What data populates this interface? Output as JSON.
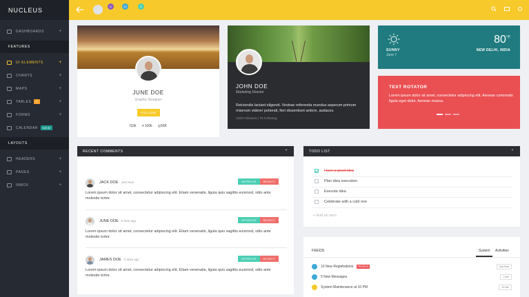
{
  "brand": "NUCLEUS",
  "sidebar": {
    "items_top": [
      {
        "label": "DASHBOARDS",
        "icon": "dashboard-icon"
      }
    ],
    "section_features": "FEATURES",
    "features": [
      {
        "label": "UI ELEMENTS",
        "icon": "ui-elements-icon",
        "active": true
      },
      {
        "label": "CHARTS",
        "icon": "charts-icon"
      },
      {
        "label": "MAPS",
        "icon": "maps-icon"
      },
      {
        "label": "TABLES",
        "icon": "tables-icon",
        "badge": "2"
      },
      {
        "label": "FORMS",
        "icon": "forms-icon"
      },
      {
        "label": "CALENDAR",
        "icon": "calendar-icon",
        "badge": "NEW"
      }
    ],
    "section_layouts": "LAYOUTS",
    "layouts": [
      {
        "label": "HEADERS",
        "icon": "headers-icon"
      },
      {
        "label": "PAGES",
        "icon": "pages-icon"
      },
      {
        "label": "INBOX",
        "icon": "inbox-icon"
      }
    ]
  },
  "topbar": {
    "badges": [
      "8",
      "10",
      "5"
    ]
  },
  "profile1": {
    "name": "JUNE DOE",
    "role": "Graphic Designer",
    "follow": "FOLLOW",
    "facebook": "10k",
    "twitter": "100k",
    "instagram": "50K"
  },
  "profile2": {
    "name": "JOHN DOE",
    "role": "Marketing Director",
    "bio": "Reiciendis lactant eligendi. Vestrae referenda mundus asperum primum miserum viderer potiendi, fieri dissentiunt ardore, audaces.",
    "followers": "1200 Followers",
    "following": "78 Following"
  },
  "weather": {
    "city": "SUNNY",
    "date": "June 7",
    "temp": "80",
    "unit": "°F",
    "location": "NEW DELHI, INDIA"
  },
  "rotator": {
    "title": "TEXT ROTATOR",
    "text": "Lorem ipsum dolor sit amet, consectetur adipiscing elit. Aenean commodo ligula eget dolor. Aenean massa."
  },
  "comments": {
    "title": "RECENT COMMENTS",
    "approve": "APPROVE",
    "reject": "REJECT",
    "items": [
      {
        "name": "JACK DOE",
        "time": "Just Now",
        "text": "Lorem ipsum dolor sit amet, consectetur adipiscing elit. Etiam venenatis, ligula quis sagittis euismod, odio ante molestie tortor."
      },
      {
        "name": "JUNE DOE",
        "time": "5 hour ago",
        "text": "Lorem ipsum dolor sit amet, consectetur adipiscing elit. Etiam venenatis, ligula quis sagittis euismod, odio ante molestie tortor."
      },
      {
        "name": "JAMES DOE",
        "time": "2 days ago",
        "text": "Lorem ipsum dolor sit amet, consectetur adipiscing elit. Etiam venenatis, ligula quis sagittis euismod, odio ante molestie tortor."
      }
    ]
  },
  "todo": {
    "title": "TODO LIST",
    "items": [
      {
        "label": "Have a good idea",
        "done": true
      },
      {
        "label": "Plan idea execution",
        "done": false
      },
      {
        "label": "Execute idea",
        "done": false
      },
      {
        "label": "Celebrate with a cold one",
        "done": false
      }
    ],
    "add": "+ Add an item"
  },
  "feeds": {
    "title": "FEEDS",
    "tabs": [
      "System",
      "Activities"
    ],
    "items": [
      {
        "label": "10 New Registrations",
        "badge": "PENDING",
        "time": "Just Now",
        "color": "#3fa9d8"
      },
      {
        "label": "5 New Messages",
        "time": "7 min",
        "color": "#3fa9d8"
      },
      {
        "label": "System Maintenance at 10 PM",
        "time": "12 min",
        "color": "#f7c92b"
      }
    ]
  },
  "colors": {
    "accent": "#f7c92b",
    "sidebar": "#262a33",
    "teal": "#1f7b7f",
    "red": "#ea4f52"
  }
}
